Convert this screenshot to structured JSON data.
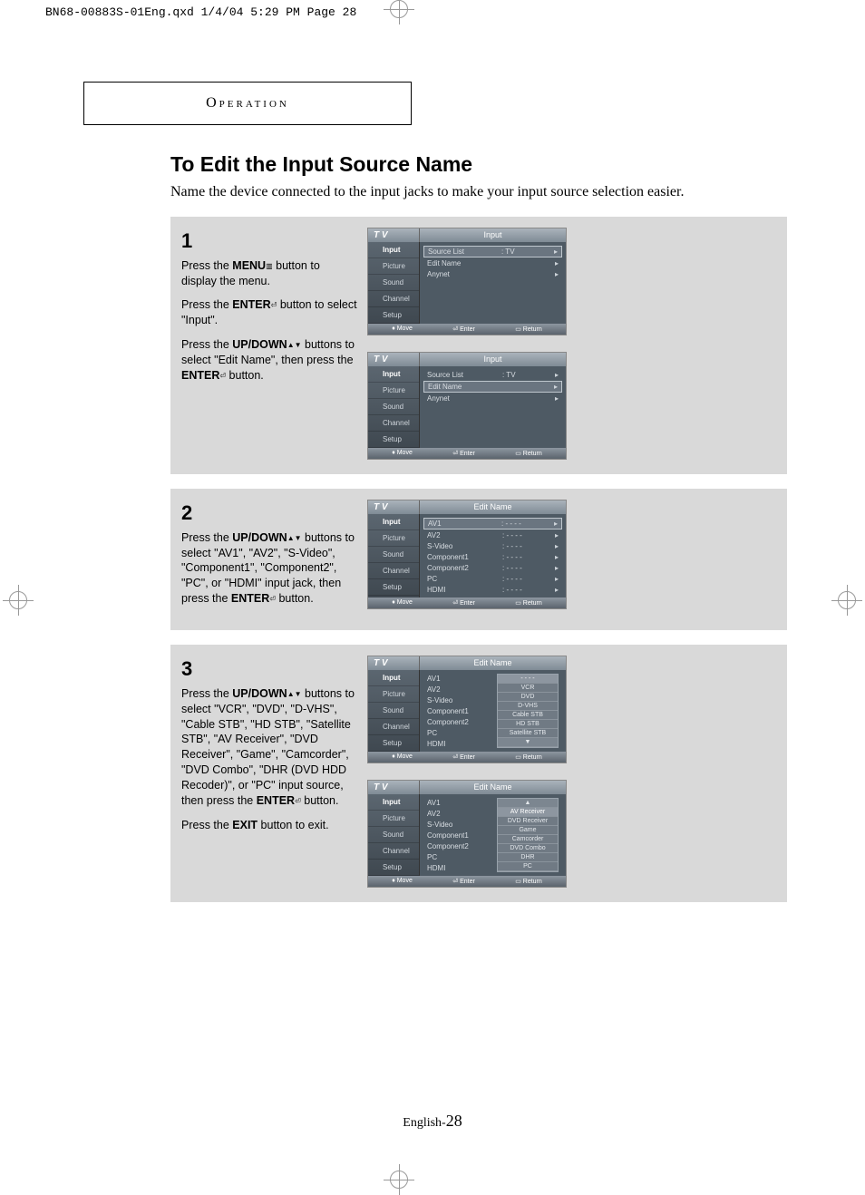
{
  "print_header": "BN68-00883S-01Eng.qxd  1/4/04 5:29 PM  Page 28",
  "section_label": "Operation",
  "title": "To Edit the Input Source Name",
  "intro": "Name the device connected to the input jacks to make your input source selection easier.",
  "steps": {
    "s1": {
      "num": "1",
      "p1a": "Press the ",
      "p1b": "MENU",
      "p1c": " button to display the menu.",
      "p2a": "Press the ",
      "p2b": "ENTER",
      "p2c": " button to select \"Input\".",
      "p3a": "Press the ",
      "p3b": "UP/DOWN",
      "p3c": " buttons to select \"Edit Name\", then press the ",
      "p3d": "ENTER",
      "p3e": " button."
    },
    "s2": {
      "num": "2",
      "p1a": "Press the ",
      "p1b": "UP/DOWN",
      "p1c": " buttons to select \"AV1\", \"AV2\", \"S-Video\", \"Component1\", \"Component2\", \"PC\", or \"HDMI\" input jack, then press the ",
      "p1d": "ENTER",
      "p1e": " button."
    },
    "s3": {
      "num": "3",
      "p1a": "Press the ",
      "p1b": "UP/DOWN",
      "p1c": " buttons to select \"VCR\", \"DVD\", \"D-VHS\", \"Cable STB\", \"HD STB\", \"Satellite STB\", \"AV Receiver\", \"DVD Receiver\", \"Game\", \"Camcorder\", \"DVD Combo\", \"DHR (DVD HDD Recoder)\", or \"PC\" input source, then press the ",
      "p1d": "ENTER",
      "p1e": " button.",
      "p2a": "Press the ",
      "p2b": "EXIT",
      "p2c": " button to exit."
    }
  },
  "osd": {
    "tv": "T V",
    "side": [
      "Input",
      "Picture",
      "Sound",
      "Channel",
      "Setup"
    ],
    "title_input": "Input",
    "title_edit": "Edit Name",
    "rows_input": [
      {
        "l": "Source List",
        "v": ": TV",
        "a": "▸"
      },
      {
        "l": "Edit Name",
        "v": "",
        "a": "▸"
      },
      {
        "l": "Anynet",
        "v": "",
        "a": "▸"
      }
    ],
    "rows_edit": [
      {
        "l": "AV1",
        "v": ": - - - -",
        "a": "▸"
      },
      {
        "l": "AV2",
        "v": ": - - - -",
        "a": "▸"
      },
      {
        "l": "S-Video",
        "v": ": - - - -",
        "a": "▸"
      },
      {
        "l": "Component1",
        "v": ": - - - -",
        "a": "▸"
      },
      {
        "l": "Component2",
        "v": ": - - - -",
        "a": "▸"
      },
      {
        "l": "PC",
        "v": ": - - - -",
        "a": "▸"
      },
      {
        "l": "HDMI",
        "v": ": - - - -",
        "a": "▸"
      }
    ],
    "rows_edit_plain": [
      "AV1",
      "AV2",
      "S-Video",
      "Component1",
      "Component2",
      "PC",
      "HDMI"
    ],
    "drop1": [
      "- - - -",
      "VCR",
      "DVD",
      "D-VHS",
      "Cable STB",
      "HD STB",
      "Satellite STB"
    ],
    "drop2": [
      "AV Receiver",
      "DVD Receiver",
      "Game",
      "Camcorder",
      "DVD Combo",
      "DHR",
      "PC"
    ],
    "foot_move": "Move",
    "foot_enter": "Enter",
    "foot_return": "Return"
  },
  "icons": {
    "menu": "▥",
    "enter": "⏎",
    "updown": "▲▼",
    "move": "♦",
    "ret": "▭"
  },
  "footer_lang": "English-",
  "footer_page": "28"
}
